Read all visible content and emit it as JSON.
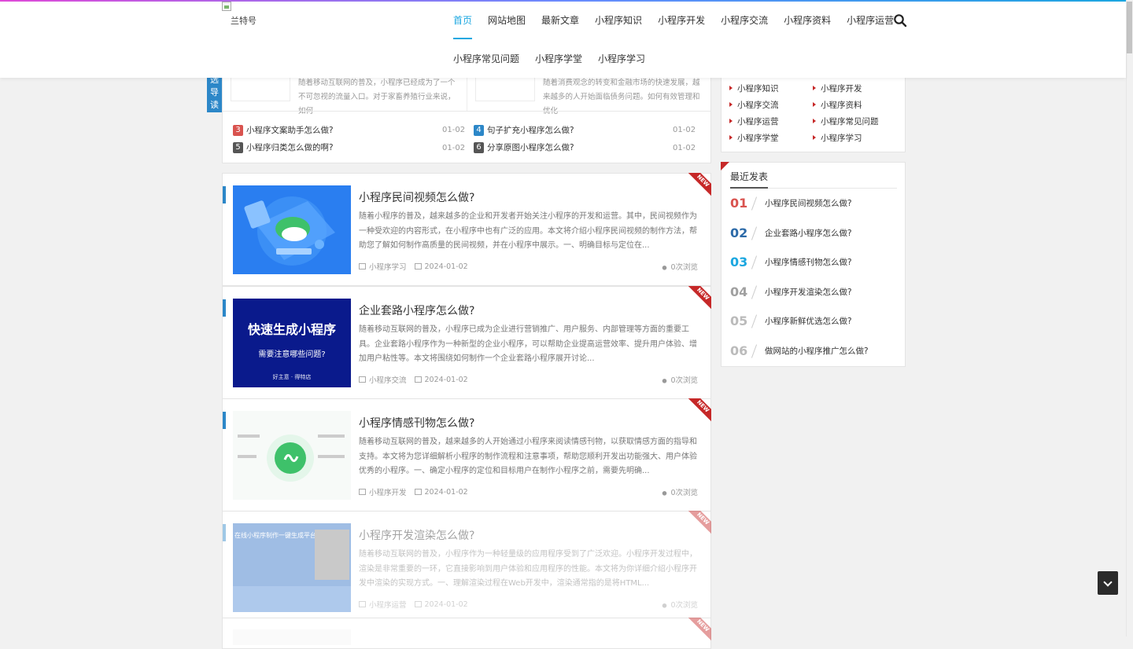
{
  "colors": {
    "accent": "#1ba7e0",
    "tag_blue": "#2c87c8",
    "new_red": "#c62828",
    "rank_colors": [
      "#d9534f",
      "#2c87c8",
      "#1ba7e0",
      "#999999",
      "#bbbbbb",
      "#bbbbbb"
    ]
  },
  "header": {
    "logo_text": "兰特号",
    "nav_primary": [
      "首页",
      "网站地图",
      "最新文章",
      "小程序知识",
      "小程序开发",
      "小程序交流",
      "小程序资料",
      "小程序运营"
    ],
    "nav_secondary": [
      "小程序常见问题",
      "小程序学堂",
      "小程序学习"
    ],
    "active_index": 0
  },
  "guide": {
    "tag": "导读",
    "tag_top_partial": "选",
    "left_excerpt": "随着移动互联网的普及，小程序已经成为了一个不可忽视的流量入口。对于家畜养殖行业来说，如何",
    "right_excerpt": "随着消费观念的转变和金融市场的快速发展，越来越多的人开始面临债务问题。如何有效管理和优化",
    "ranked": [
      {
        "num": "3",
        "title": "小程序文案助手怎么做?",
        "date": "01-02"
      },
      {
        "num": "4",
        "title": "句子扩充小程序怎么做?",
        "date": "01-02"
      },
      {
        "num": "5",
        "title": "小程序归类怎么做的啊?",
        "date": "01-02"
      },
      {
        "num": "6",
        "title": "分享原图小程序怎么做?",
        "date": "01-02"
      }
    ]
  },
  "posts": [
    {
      "title": "小程序民间视频怎么做?",
      "excerpt": "随着小程序的普及，越来越多的企业和开发者开始关注小程序的开发和运营。其中，民间视频作为一种受欢迎的内容形式，在小程序中也有广泛的应用。本文将介绍小程序民间视频的制作方法，帮助您了解如何制作高质量的民间视频，并在小程序中展示。一、明确目标与定位在...",
      "category": "小程序学习",
      "date": "2024-01-02",
      "views": "0次浏览",
      "badge": "NEW"
    },
    {
      "title": "企业套路小程序怎么做?",
      "excerpt": "随着移动互联网的普及，小程序已成为企业进行营销推广、用户服务、内部管理等方面的重要工具。企业套路小程序作为一种新型的企业小程序，可以帮助企业提高运营效率、提升用户体验、增加用户粘性等。本文将围绕如何制作一个企业套路小程序展开讨论...",
      "category": "小程序交流",
      "date": "2024-01-02",
      "views": "0次浏览",
      "badge": "NEW",
      "thumb_text": "快速生成小程序",
      "thumb_sub": "需要注意哪些问题?",
      "thumb_foot": "好主意 · 得特店"
    },
    {
      "title": "小程序情感刊物怎么做?",
      "excerpt": "随着移动互联网的普及，越来越多的人开始通过小程序来阅读情感刊物，以获取情感方面的指导和支持。本文将为您详细解析小程序的制作流程和注意事项，帮助您顺利开发出功能强大、用户体验优秀的小程序。一、确定小程序的定位和目标用户在制作小程序之前，需要先明确...",
      "category": "小程序开发",
      "date": "2024-01-02",
      "views": "0次浏览",
      "badge": "NEW"
    },
    {
      "title": "小程序开发渲染怎么做?",
      "excerpt": "随着移动互联网的普及，小程序作为一种轻量级的应用程序受到了广泛欢迎。小程序开发过程中，渲染是非常重要的一环，它直接影响到用户体验和应用程序的性能。本文将为你详细介绍小程序开发中渲染的实现方式。一、理解渲染过程在Web开发中，渲染通常指的是将HTML...",
      "category": "小程序运营",
      "date": "2024-01-02",
      "views": "0次浏览",
      "badge": "NEW",
      "thumb_text": "在线小程序制作一键生成平台"
    },
    {
      "badge": "NEW"
    }
  ],
  "sidebar": {
    "categories": [
      "小程序知识",
      "小程序开发",
      "小程序交流",
      "小程序资料",
      "小程序运营",
      "小程序常见问题",
      "小程序学堂",
      "小程序学习"
    ],
    "recent_title": "最近发表",
    "recent": [
      {
        "num": "01",
        "title": "小程序民间视频怎么做?"
      },
      {
        "num": "02",
        "title": "企业套路小程序怎么做?"
      },
      {
        "num": "03",
        "title": "小程序情感刊物怎么做?"
      },
      {
        "num": "04",
        "title": "小程序开发渲染怎么做?"
      },
      {
        "num": "05",
        "title": "小程序新鲜优选怎么做?"
      },
      {
        "num": "06",
        "title": "做网站的小程序推广怎么做?"
      }
    ]
  }
}
